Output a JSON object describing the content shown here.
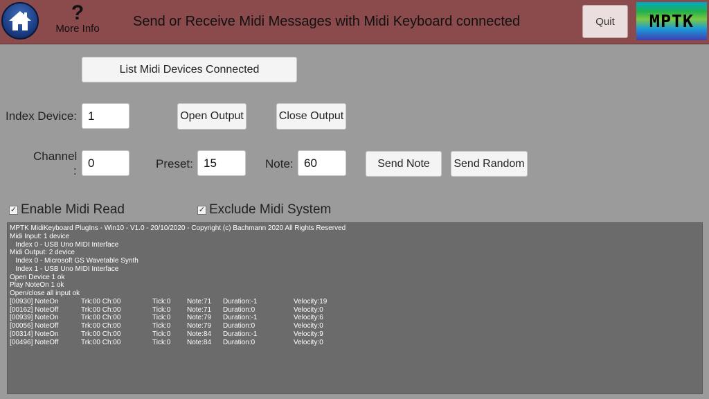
{
  "header": {
    "home_icon": "home-icon",
    "more_info_glyph": "?",
    "more_info_label": "More Info",
    "title": "Send or Receive Midi Messages with Midi Keyboard connected",
    "quit_label": "Quit",
    "logo_text": "MPTK"
  },
  "controls": {
    "list_devices_label": "List Midi Devices Connected",
    "index_device_label": "Index Device:",
    "index_device_value": "1",
    "open_output_label": "Open Output",
    "close_output_label": "Close Output",
    "channel_label_1": "Channel",
    "channel_label_2": ":",
    "channel_value": "0",
    "preset_label": "Preset:",
    "preset_value": "15",
    "note_label": "Note:",
    "note_value": "60",
    "send_note_label": "Send Note",
    "send_random_label": "Send Random",
    "enable_midi_read_label": "Enable Midi Read",
    "enable_midi_read_checked": true,
    "exclude_midi_system_label": "Exclude Midi System",
    "exclude_midi_system_checked": true
  },
  "log": {
    "lines": [
      "MPTK MidiKeyboard PlugIns - Win10 - V1.0 - 20/10/2020 - Copyright (c) Bachmann 2020 All Rights Reserved",
      "Midi Input: 1 device",
      "   Index 0 - USB Uno MIDI Interface",
      "Midi Output: 2 device",
      "   Index 0 - Microsoft GS Wavetable Synth",
      "   Index 1 - USB Uno MIDI Interface",
      "Open Device 1 ok",
      "Play NoteOn 1 ok",
      "Open/close all input ok"
    ],
    "events": [
      {
        "id": "[00930] NoteOn",
        "trk": "Trk:00 Ch:00",
        "tick": "Tick:0",
        "note": "Note:71",
        "duration": "Duration:-1",
        "velocity": "Velocity:19"
      },
      {
        "id": "[00162] NoteOff",
        "trk": "Trk:00 Ch:00",
        "tick": "Tick:0",
        "note": "Note:71",
        "duration": "Duration:0",
        "velocity": "Velocity:0"
      },
      {
        "id": "[00939] NoteOn",
        "trk": "Trk:00 Ch:00",
        "tick": "Tick:0",
        "note": "Note:79",
        "duration": "Duration:-1",
        "velocity": "Velocity:6"
      },
      {
        "id": "[00056] NoteOff",
        "trk": "Trk:00 Ch:00",
        "tick": "Tick:0",
        "note": "Note:79",
        "duration": "Duration:0",
        "velocity": "Velocity:0"
      },
      {
        "id": "[00314] NoteOn",
        "trk": "Trk:00 Ch:00",
        "tick": "Tick:0",
        "note": "Note:84",
        "duration": "Duration:-1",
        "velocity": "Velocity:9"
      },
      {
        "id": "[00496] NoteOff",
        "trk": "Trk:00 Ch:00",
        "tick": "Tick:0",
        "note": "Note:84",
        "duration": "Duration:0",
        "velocity": "Velocity:0"
      }
    ]
  }
}
